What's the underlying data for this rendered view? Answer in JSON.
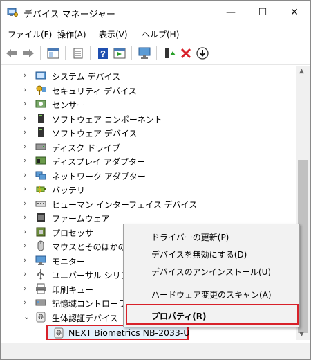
{
  "window": {
    "title": "デバイス マネージャー",
    "minimize": "—",
    "maximize": "☐",
    "close": "✕"
  },
  "menu": [
    "ファイル(F)",
    "操作(A)",
    "表示(V)",
    "ヘルプ(H)"
  ],
  "toolbar": [
    "back-arrow-icon",
    "forward-arrow-icon",
    "properties-pane-icon",
    "device-list-icon",
    "help-icon",
    "run-icon",
    "monitor-scan-icon",
    "update-driver-icon",
    "uninstall-x-icon",
    "disable-down-icon"
  ],
  "tree": {
    "items": [
      {
        "label": "システム デバイス",
        "icon": "system-device-icon"
      },
      {
        "label": "セキュリティ デバイス",
        "icon": "security-key-icon"
      },
      {
        "label": "センサー",
        "icon": "sensor-icon"
      },
      {
        "label": "ソフトウェア コンポーネント",
        "icon": "software-component-icon"
      },
      {
        "label": "ソフトウェア デバイス",
        "icon": "software-device-icon"
      },
      {
        "label": "ディスク ドライブ",
        "icon": "disk-drive-icon"
      },
      {
        "label": "ディスプレイ アダプター",
        "icon": "display-adapter-icon"
      },
      {
        "label": "ネットワーク アダプター",
        "icon": "network-adapter-icon"
      },
      {
        "label": "バッテリ",
        "icon": "battery-icon"
      },
      {
        "label": "ヒューマン インターフェイス デバイス",
        "icon": "hid-icon"
      },
      {
        "label": "ファームウェア",
        "icon": "firmware-icon"
      },
      {
        "label": "プロセッサ",
        "icon": "processor-icon"
      },
      {
        "label": "マウスとそのほかのポ",
        "icon": "mouse-icon"
      },
      {
        "label": "モニター",
        "icon": "monitor-icon"
      },
      {
        "label": "ユニバーサル シリアル",
        "icon": "usb-icon"
      },
      {
        "label": "印刷キュー",
        "icon": "print-queue-icon"
      },
      {
        "label": "記憶域コントローラー",
        "icon": "storage-controller-icon"
      },
      {
        "label": "生体認証デバイス",
        "icon": "biometric-icon"
      }
    ],
    "selected_child": "NEXT Biometrics NB-2033-U"
  },
  "context_menu": {
    "items": [
      "ドライバーの更新(P)",
      "デバイスを無効にする(D)",
      "デバイスのアンインストール(U)",
      "ハードウェア変更のスキャン(A)",
      "プロパティ(R)"
    ]
  },
  "colors": {
    "highlight_border": "#d8212a",
    "selection_bg": "#e5f1fb"
  }
}
